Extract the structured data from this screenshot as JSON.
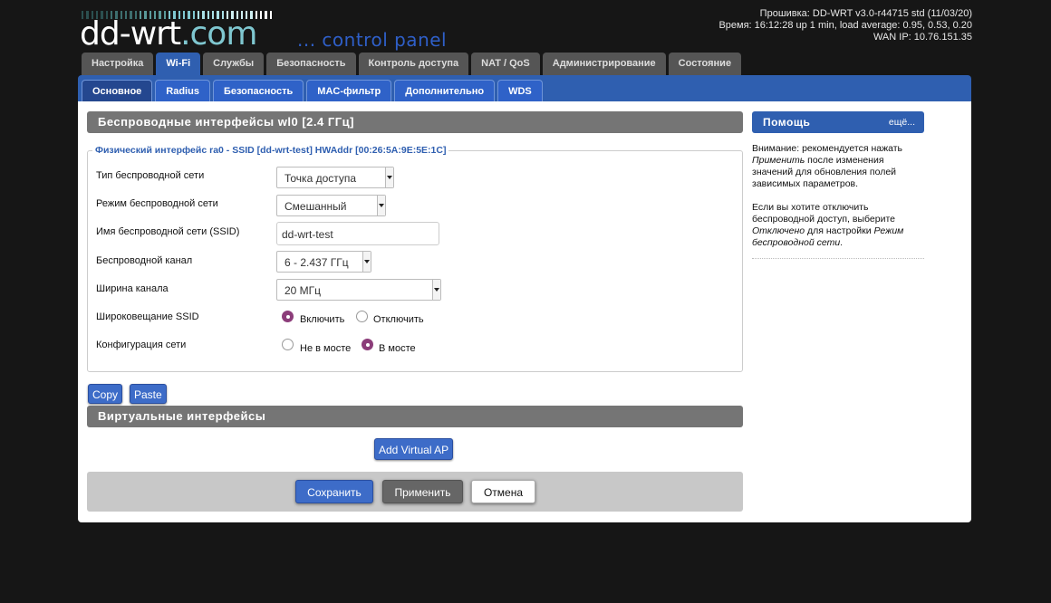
{
  "header": {
    "logo_main": "dd-wrt",
    "logo_dot": ".",
    "logo_com": "com",
    "logo_sub": "... control panel",
    "status_line1": "Прошивка: DD-WRT v3.0-r44715 std (11/03/20)",
    "status_line2": "Время: 16:12:28 up 1 min, load average: 0.95, 0.53, 0.20",
    "status_line3": "WAN IP: 10.76.151.35"
  },
  "main_tabs": [
    "Настройка",
    "Wi-Fi",
    "Службы",
    "Безопасность",
    "Контроль доступа",
    "NAT / QoS",
    "Администрирование",
    "Состояние"
  ],
  "sub_tabs": [
    "Основное",
    "Radius",
    "Безопасность",
    "MAC-фильтр",
    "Дополнительно",
    "WDS"
  ],
  "wireless": {
    "section_title": "Беспроводные интерфейсы wl0 [2.4 ГГц]",
    "legend": "Физический интерфейс ra0 - SSID [dd-wrt-test] HWAddr [00:26:5A:9E:5E:1C]",
    "rows": {
      "type_label": "Тип беспроводной сети",
      "type_value": "Точка доступа",
      "mode_label": "Режим беспроводной сети",
      "mode_value": "Смешанный",
      "ssid_label": "Имя беспроводной сети (SSID)",
      "ssid_value": "dd-wrt-test",
      "channel_label": "Беспроводной канал",
      "channel_value": "6 - 2.437 ГГц",
      "width_label": "Ширина канала",
      "width_value": "20 МГц",
      "broadcast_label": "Широковещание SSID",
      "broadcast_on": "Включить",
      "broadcast_off": "Отключить",
      "netconf_label": "Конфигурация сети",
      "netconf_unbridged": "Не в мосте",
      "netconf_bridged": "В мосте"
    },
    "copy_label": "Copy",
    "paste_label": "Paste"
  },
  "virtual": {
    "section_title": "Виртуальные интерфейсы",
    "add_label": "Add Virtual AP"
  },
  "actions": {
    "save": "Сохранить",
    "apply": "Применить",
    "cancel": "Отмена"
  },
  "help": {
    "title": "Помощь",
    "more": "ещё...",
    "p1_a": "Внимание: рекомендуется нажать ",
    "p1_em": "Применить",
    "p1_b": " после изменения значений для обновления полей зависимых параметров.",
    "p2_a": "Если вы хотите отключить беспроводной доступ, выберите ",
    "p2_em1": "Отключено",
    "p2_b": " для настройки ",
    "p2_em2": "Режим беспроводной сети",
    "p2_c": "."
  },
  "colors": {
    "accent": "#2f5fb0",
    "radio_selected": "#8c3d7a",
    "section_header": "#757575",
    "background": "#161616"
  }
}
